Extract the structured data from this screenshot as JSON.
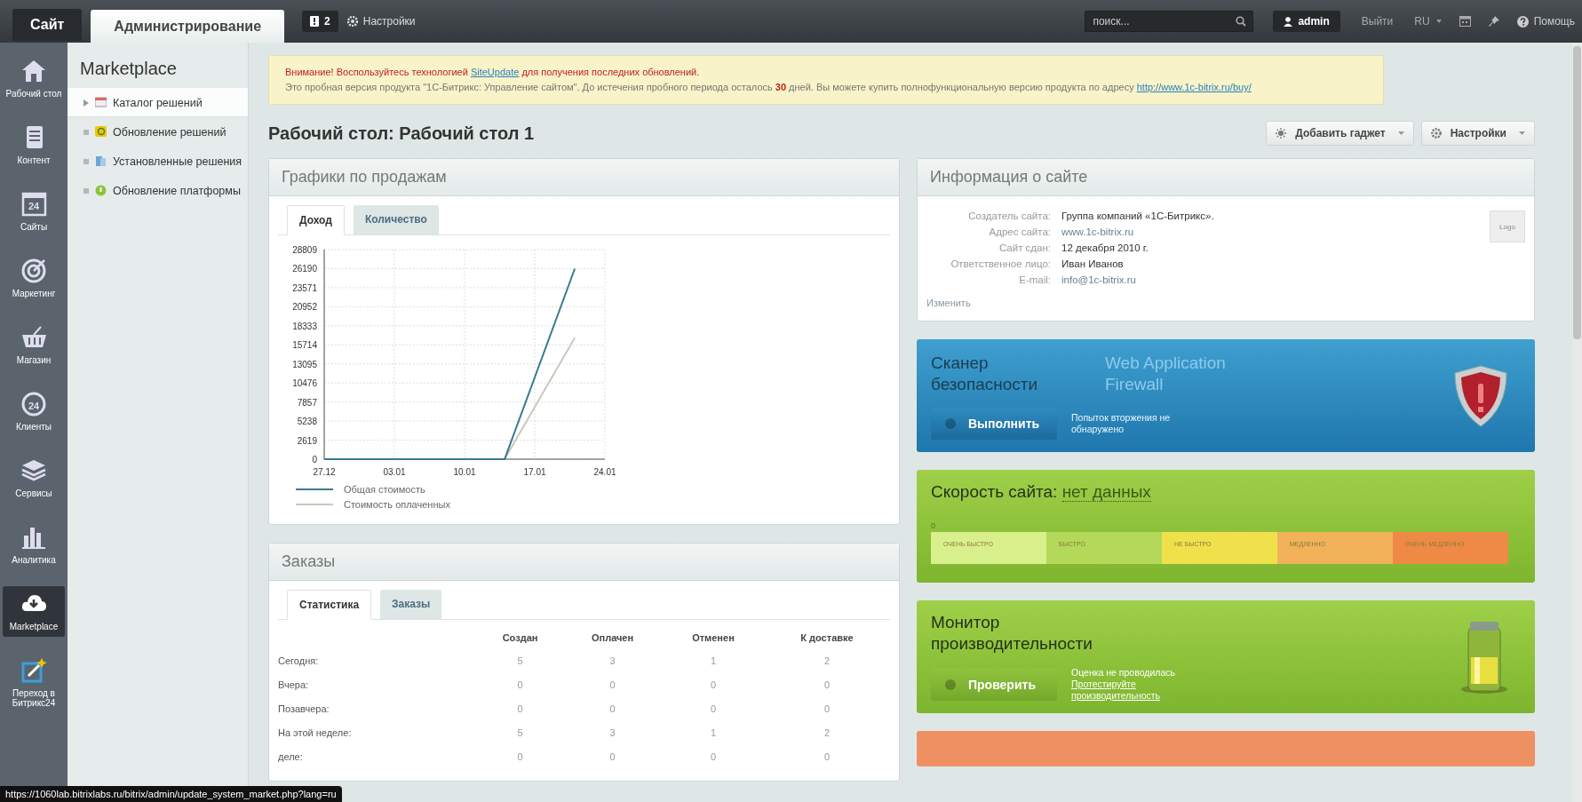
{
  "top_bar": {
    "tabs": [
      {
        "label": "Сайт",
        "selected": false
      },
      {
        "label": "Администрирование",
        "selected": true
      }
    ],
    "notifications": "2",
    "settings": "Настройки",
    "search": {
      "placeholder": "поиск..."
    },
    "user": "admin",
    "logout": "Выйти",
    "language": "RU",
    "help": "Помощь"
  },
  "sidebar": {
    "items": [
      {
        "label": "Рабочий стол",
        "selected": false
      },
      {
        "label": "Контент",
        "selected": false
      },
      {
        "label": "Сайты",
        "selected": false,
        "icon_text": "24"
      },
      {
        "label": "Маркетинг",
        "selected": false
      },
      {
        "label": "Магазин",
        "selected": false
      },
      {
        "label": "Клиенты",
        "selected": false,
        "icon_text": "24"
      },
      {
        "label": "Сервисы",
        "selected": false
      },
      {
        "label": "Аналитика",
        "selected": false
      },
      {
        "label": "Marketplace",
        "selected": true
      },
      {
        "label": "Переход в Битрикс24",
        "selected": false
      }
    ]
  },
  "menu": {
    "title": "Marketplace",
    "items": [
      {
        "label": "Каталог решений",
        "kind": "expandable",
        "selected": true
      },
      {
        "label": "Обновление решений",
        "kind": "leaf",
        "selected": false
      },
      {
        "label": "Установленные решения",
        "kind": "leaf",
        "selected": false
      },
      {
        "label": "Обновление платформы",
        "kind": "leaf",
        "selected": false
      }
    ]
  },
  "notice": {
    "warning": {
      "before": "Внимание! Воспользуйтесь технологией",
      "link": "SiteUpdate",
      "after": "для получения последних обновлений."
    },
    "trial": {
      "before": "Это пробная версия продукта \"1С-Битрикс: Управление сайтом\". До истечения пробного периода осталось **30** дней. Вы можете купить полнофункциональную версию продукта по адресу",
      "link": "http://www.1c-bitrix.ru/buy/"
    }
  },
  "page_title": "Рабочий стол: Рабочий стол 1",
  "toolbar": [
    {
      "label": "Добавить гаджет",
      "kind": "add"
    },
    {
      "label": "Настройки",
      "kind": "settings"
    }
  ],
  "sales_chart": {
    "title": "Графики по продажам",
    "tabs": [
      {
        "label": "Доход",
        "selected": true
      },
      {
        "label": "Количество",
        "selected": false
      }
    ],
    "chart_data": {
      "type": "line",
      "categories": [
        "27.12",
        null,
        null,
        null,
        null,
        null,
        null,
        "03.01",
        null,
        null,
        null,
        null,
        null,
        null,
        "10.01",
        null,
        null,
        null,
        null,
        null,
        null,
        "17.01",
        null,
        null,
        null,
        null,
        null,
        null,
        "24.01"
      ],
      "series": [
        {
          "name": "Общая стоимость",
          "color": "#3a7a8c",
          "values": [
            0,
            0,
            0,
            0,
            0,
            0,
            0,
            0,
            0,
            0,
            0,
            0,
            0,
            0,
            0,
            0,
            0,
            0,
            0,
            null,
            null,
            null,
            null,
            null,
            null,
            26190,
            null,
            null,
            null
          ]
        },
        {
          "name": "Стоимость оплаченных",
          "color": "#c8c8bc",
          "values": [
            null,
            null,
            null,
            null,
            null,
            null,
            null,
            null,
            null,
            null,
            null,
            null,
            null,
            null,
            null,
            null,
            null,
            null,
            0,
            null,
            null,
            null,
            null,
            null,
            null,
            16700,
            null,
            null,
            null
          ]
        }
      ],
      "ylim": [
        0,
        28809
      ],
      "grid": true,
      "legend": "bottom",
      "yticks": [
        0,
        2619,
        5238,
        7857,
        10476,
        13095,
        15714,
        18333,
        20952,
        23571,
        26190,
        28809
      ]
    }
  },
  "orders": {
    "title": "Заказы",
    "tabs": [
      {
        "label": "Статистика",
        "selected": true
      },
      {
        "label": "Заказы",
        "selected": false
      }
    ],
    "columns": [
      "Создан",
      "Оплачен",
      "Отменен",
      "К доставке"
    ],
    "rows": [
      {
        "label": "Сегодня:",
        "values": [
          "5",
          "3",
          "1",
          "2"
        ]
      },
      {
        "label": "Вчера:",
        "values": [
          "0",
          "0",
          "0",
          "0"
        ]
      },
      {
        "label": "Позавчера:",
        "values": [
          "0",
          "0",
          "0",
          "0"
        ]
      },
      {
        "label": "На этой неделе:",
        "values": [
          "5",
          "3",
          "1",
          "2"
        ]
      },
      {
        "label": "деле:",
        "values": [
          "0",
          "0",
          "0",
          "0"
        ]
      }
    ]
  },
  "site_info": {
    "title": "Информация о сайте",
    "logo": "Logo",
    "fields": [
      {
        "label": "Создатель сайта:",
        "value": "Группа компаний «1С-Битрикс».",
        "kind": "text"
      },
      {
        "label": "Адрес сайта:",
        "value": "www.1c-bitrix.ru",
        "kind": "link"
      },
      {
        "label": "Сайт сдан:",
        "value": "12 декабря 2010 г.",
        "kind": "text"
      },
      {
        "label": "Ответственное лицо:",
        "value": "Иван Иванов",
        "kind": "text"
      },
      {
        "label": "E-mail:",
        "value": "info@1c-bitrix.ru",
        "kind": "link"
      }
    ],
    "edit": "Изменить"
  },
  "scanner": {
    "title": "Сканер безопасности",
    "subtitle": "Web Application Firewall",
    "button": "Выполнить",
    "status": "Попыток вторжения не обнаружено"
  },
  "speed": {
    "title": "Скорость сайта:",
    "value": "нет данных",
    "zero": "0",
    "scale": [
      "ОЧЕНЬ БЫСТРО",
      "БЫСТРО",
      "НЕ БЫСТРО",
      "МЕДЛЕННО",
      "ОЧЕНЬ МЕДЛЕННО"
    ]
  },
  "monitor": {
    "title": "Монитор производительности",
    "button": "Проверить",
    "status": "Оценка не проводилась",
    "link": "Протестируйте производительность"
  },
  "status_bar": "https://1060lab.bitrixlabs.ru/bitrix/admin/update_system_market.php?lang=ru"
}
